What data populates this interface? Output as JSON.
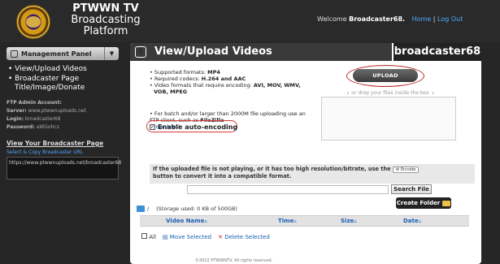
{
  "brand": {
    "line1": "PTWWN TV",
    "line2": "Broadcasting",
    "line3": "Platform"
  },
  "topbar": {
    "welcome_prefix": "Welcome",
    "username": "Broadcaster68.",
    "home": "Home",
    "separator": "|",
    "logout": "Log Out"
  },
  "sidebar": {
    "panel_label": "Management Panel",
    "items": [
      {
        "label": "View/Upload Videos"
      },
      {
        "label": "Broadcaster Page Title/Image/Donate"
      }
    ],
    "ftp": {
      "title": "FTP Admin Account:",
      "server_label": "Server:",
      "server": "www.ptwwnuploads.net",
      "login_label": "Login:",
      "login": "broadcaster68",
      "password_label": "Password:",
      "password": "aWGohcz"
    },
    "view_page_link": "View Your Broadcaster Page",
    "copy_label": "Select & Copy Broadcaster URL",
    "url_value": "https://www.ptwwnuploads.net/broadcaster68"
  },
  "main": {
    "title": "View/Upload Videos",
    "account": "broadcaster68",
    "formats": [
      {
        "text": "Supported formats: ",
        "bold": "MP4"
      },
      {
        "text": "Required codecs: ",
        "bold": "H.264 and AAC"
      },
      {
        "text": "Video formats that require encoding: ",
        "bold": "AVI, MOV, WMV, VOB, MPEG"
      }
    ],
    "batch_text": "For batch and/or larger than 2000M file uploading use an FTP client, such as ",
    "batch_bold": "FileZilla",
    "download_link": "(Download)",
    "auto_encoding": "Enable auto-encoding",
    "upload_button": "UPLOAD",
    "drop_text": "⇣ or drop your files inside the box ⇣",
    "notice_pre": "If the uploaded file is not playing, or it has too high resolution/bitrate, use the",
    "encode_button": "Encode",
    "notice_post": "button to convert it into a compatible format.",
    "search_value": "",
    "search_button": "Search File",
    "create_folder": "Create Folder",
    "path": "/",
    "storage": "(Storage used: 0 KB of 500GB)",
    "columns": {
      "name": "Video Name▵",
      "time": "Time▵",
      "size": "Size▵",
      "date": "Date▵"
    },
    "select_all": "All",
    "move_selected": "Move Selected",
    "delete_selected": "Delete Selected"
  },
  "footer": "©2022 PTWWNTV. All rights reserved."
}
